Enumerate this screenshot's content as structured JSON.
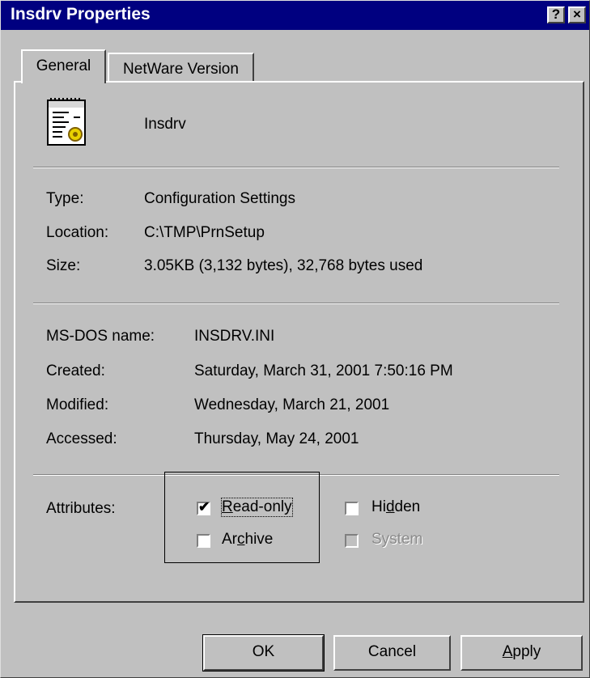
{
  "window": {
    "title": "Insdrv Properties",
    "help_glyph": "?",
    "close_glyph": "×"
  },
  "tabs": [
    {
      "label": "General"
    },
    {
      "label": "NetWare Version"
    }
  ],
  "file": {
    "name": "Insdrv",
    "icon": "ini-file-icon"
  },
  "info": [
    {
      "label": "Type:",
      "value": "Configuration Settings"
    },
    {
      "label": "Location:",
      "value": "C:\\TMP\\PrnSetup"
    },
    {
      "label": "Size:",
      "value": "3.05KB (3,132 bytes), 32,768 bytes used"
    }
  ],
  "dates": [
    {
      "label": "MS-DOS name:",
      "value": "INSDRV.INI"
    },
    {
      "label": "Created:",
      "value": "Saturday, March 31, 2001 7:50:16 PM"
    },
    {
      "label": "Modified:",
      "value": "Wednesday, March 21, 2001"
    },
    {
      "label": "Accessed:",
      "value": "Thursday, May 24, 2001"
    }
  ],
  "attributes": {
    "label": "Attributes:",
    "read_only": {
      "pre": "",
      "key": "R",
      "post": "ead-only",
      "checked": true
    },
    "archive": {
      "pre": "Ar",
      "key": "c",
      "post": "hive",
      "checked": false
    },
    "hidden": {
      "pre": "Hi",
      "key": "d",
      "post": "den",
      "checked": false
    },
    "system": {
      "label": "System",
      "checked": false,
      "enabled": false
    },
    "check_glyph": "✔"
  },
  "buttons": {
    "ok": "OK",
    "cancel": "Cancel",
    "apply": {
      "key": "A",
      "rest": "pply"
    }
  }
}
